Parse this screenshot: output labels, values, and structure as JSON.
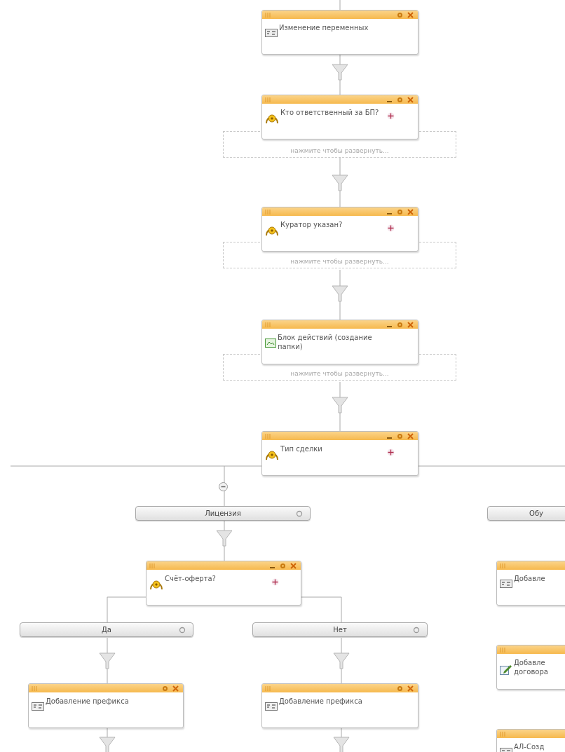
{
  "nodes": [
    {
      "kind": "assignment",
      "title": "Изменение переменных",
      "minimize": false,
      "add": false
    },
    {
      "kind": "condition",
      "title": "Кто ответственный за БП?",
      "minimize": true,
      "add": true,
      "expand_hint": "нажмите чтобы развернуть..."
    },
    {
      "kind": "condition",
      "title": "Куратор указан?",
      "minimize": true,
      "add": true,
      "expand_hint": "нажмите чтобы развернуть..."
    },
    {
      "kind": "action",
      "title": "Блок действий (создание папки)",
      "minimize": true,
      "add": false,
      "expand_hint": "нажмите чтобы развернуть..."
    },
    {
      "kind": "condition",
      "title": "Тип сделки",
      "minimize": true,
      "add": true
    },
    {
      "kind": "condition",
      "title": "Счёт-оферта?",
      "minimize": true,
      "add": true
    },
    {
      "kind": "assignment",
      "title": "Добавление префикса",
      "minimize": false,
      "add": false
    },
    {
      "kind": "assignment",
      "title": "Добавление префикса",
      "minimize": false,
      "add": false
    },
    {
      "kind": "assignment",
      "title": "Добавле",
      "minimize": false,
      "add": false
    },
    {
      "kind": "edit",
      "title": "Добавле договора",
      "minimize": false,
      "add": false
    },
    {
      "kind": "assignment",
      "title": "АЛ-Созд",
      "minimize": false,
      "add": false
    }
  ],
  "branches": [
    {
      "label": "Лицензия",
      "collapse": true
    },
    {
      "label": "Обу",
      "collapse": false
    },
    {
      "label": "Да",
      "collapse": false
    },
    {
      "label": "Нет",
      "collapse": false
    }
  ]
}
